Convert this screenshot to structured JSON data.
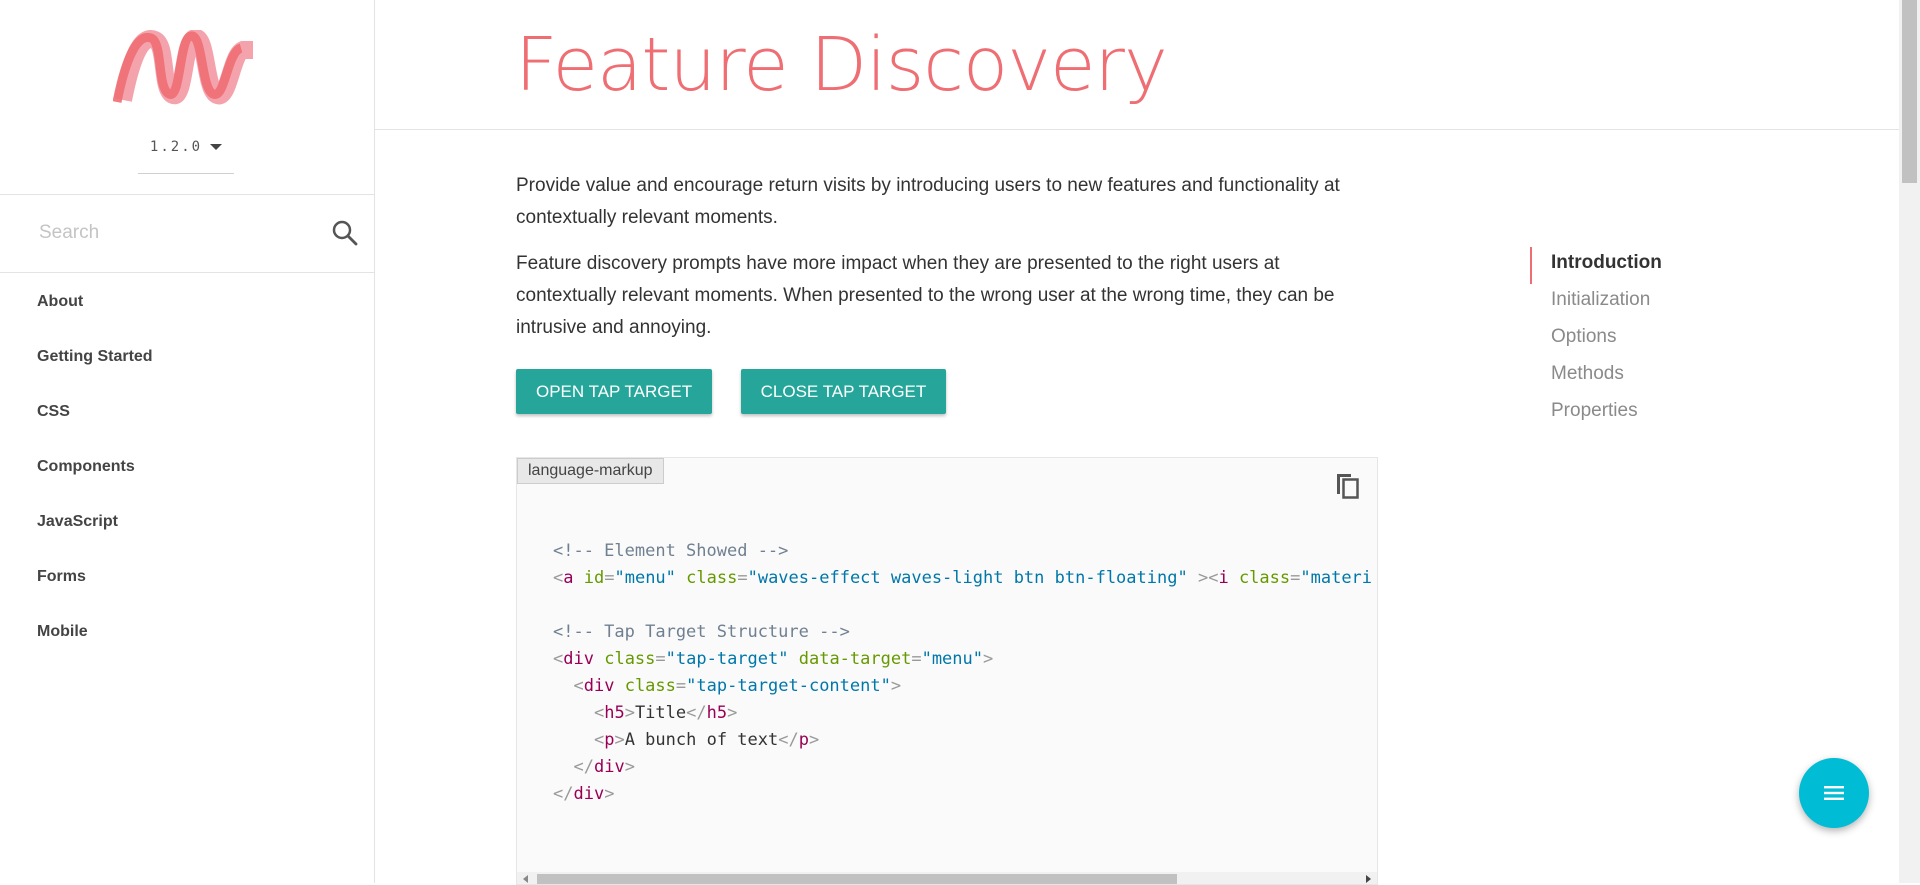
{
  "sidebar": {
    "version": "1.2.0",
    "search_placeholder": "Search",
    "nav": [
      "About",
      "Getting Started",
      "CSS",
      "Components",
      "JavaScript",
      "Forms",
      "Mobile"
    ]
  },
  "header": {
    "title": "Feature Discovery"
  },
  "main": {
    "intro_paragraphs": [
      "Provide value and encourage return visits by introducing users to new features and functionality at contextually relevant moments.",
      "Feature discovery prompts have more impact when they are presented to the right users at contextually relevant moments. When presented to the wrong user at the wrong time, they can be intrusive and annoying."
    ],
    "buttons": {
      "open": "OPEN TAP TARGET",
      "close": "CLOSE TAP TARGET"
    },
    "code": {
      "language_label": "language-markup",
      "line1_comment": "<!-- Element Showed -->",
      "line2": {
        "tag": "a",
        "attr_id": "id",
        "id_val": "\"menu\"",
        "attr_class": "class",
        "class_val": "\"waves-effect waves-light btn btn-floating\"",
        "inner_tag": "i",
        "inner_attr": "class",
        "inner_val": "\"materi"
      },
      "line4_comment": "<!-- Tap Target Structure -->",
      "line5": {
        "tag": "div",
        "attr_class": "class",
        "class_val": "\"tap-target\"",
        "attr_data": "data-target",
        "data_val": "\"menu\""
      },
      "line6": {
        "tag": "div",
        "attr_class": "class",
        "class_val": "\"tap-target-content\""
      },
      "line7": {
        "tag": "h5",
        "text": "Title"
      },
      "line8": {
        "tag": "p",
        "text": "A bunch of text"
      },
      "line9_close": "div",
      "line10_close": "div"
    }
  },
  "toc": {
    "items": [
      "Introduction",
      "Initialization",
      "Options",
      "Methods",
      "Properties"
    ],
    "active": "Introduction"
  },
  "colors": {
    "brand": "#ee6e73",
    "teal": "#26a69a",
    "fab": "#00bcd4"
  },
  "icons": {
    "search": "search-icon",
    "copy": "copy-icon",
    "fab": "menu-icon"
  }
}
